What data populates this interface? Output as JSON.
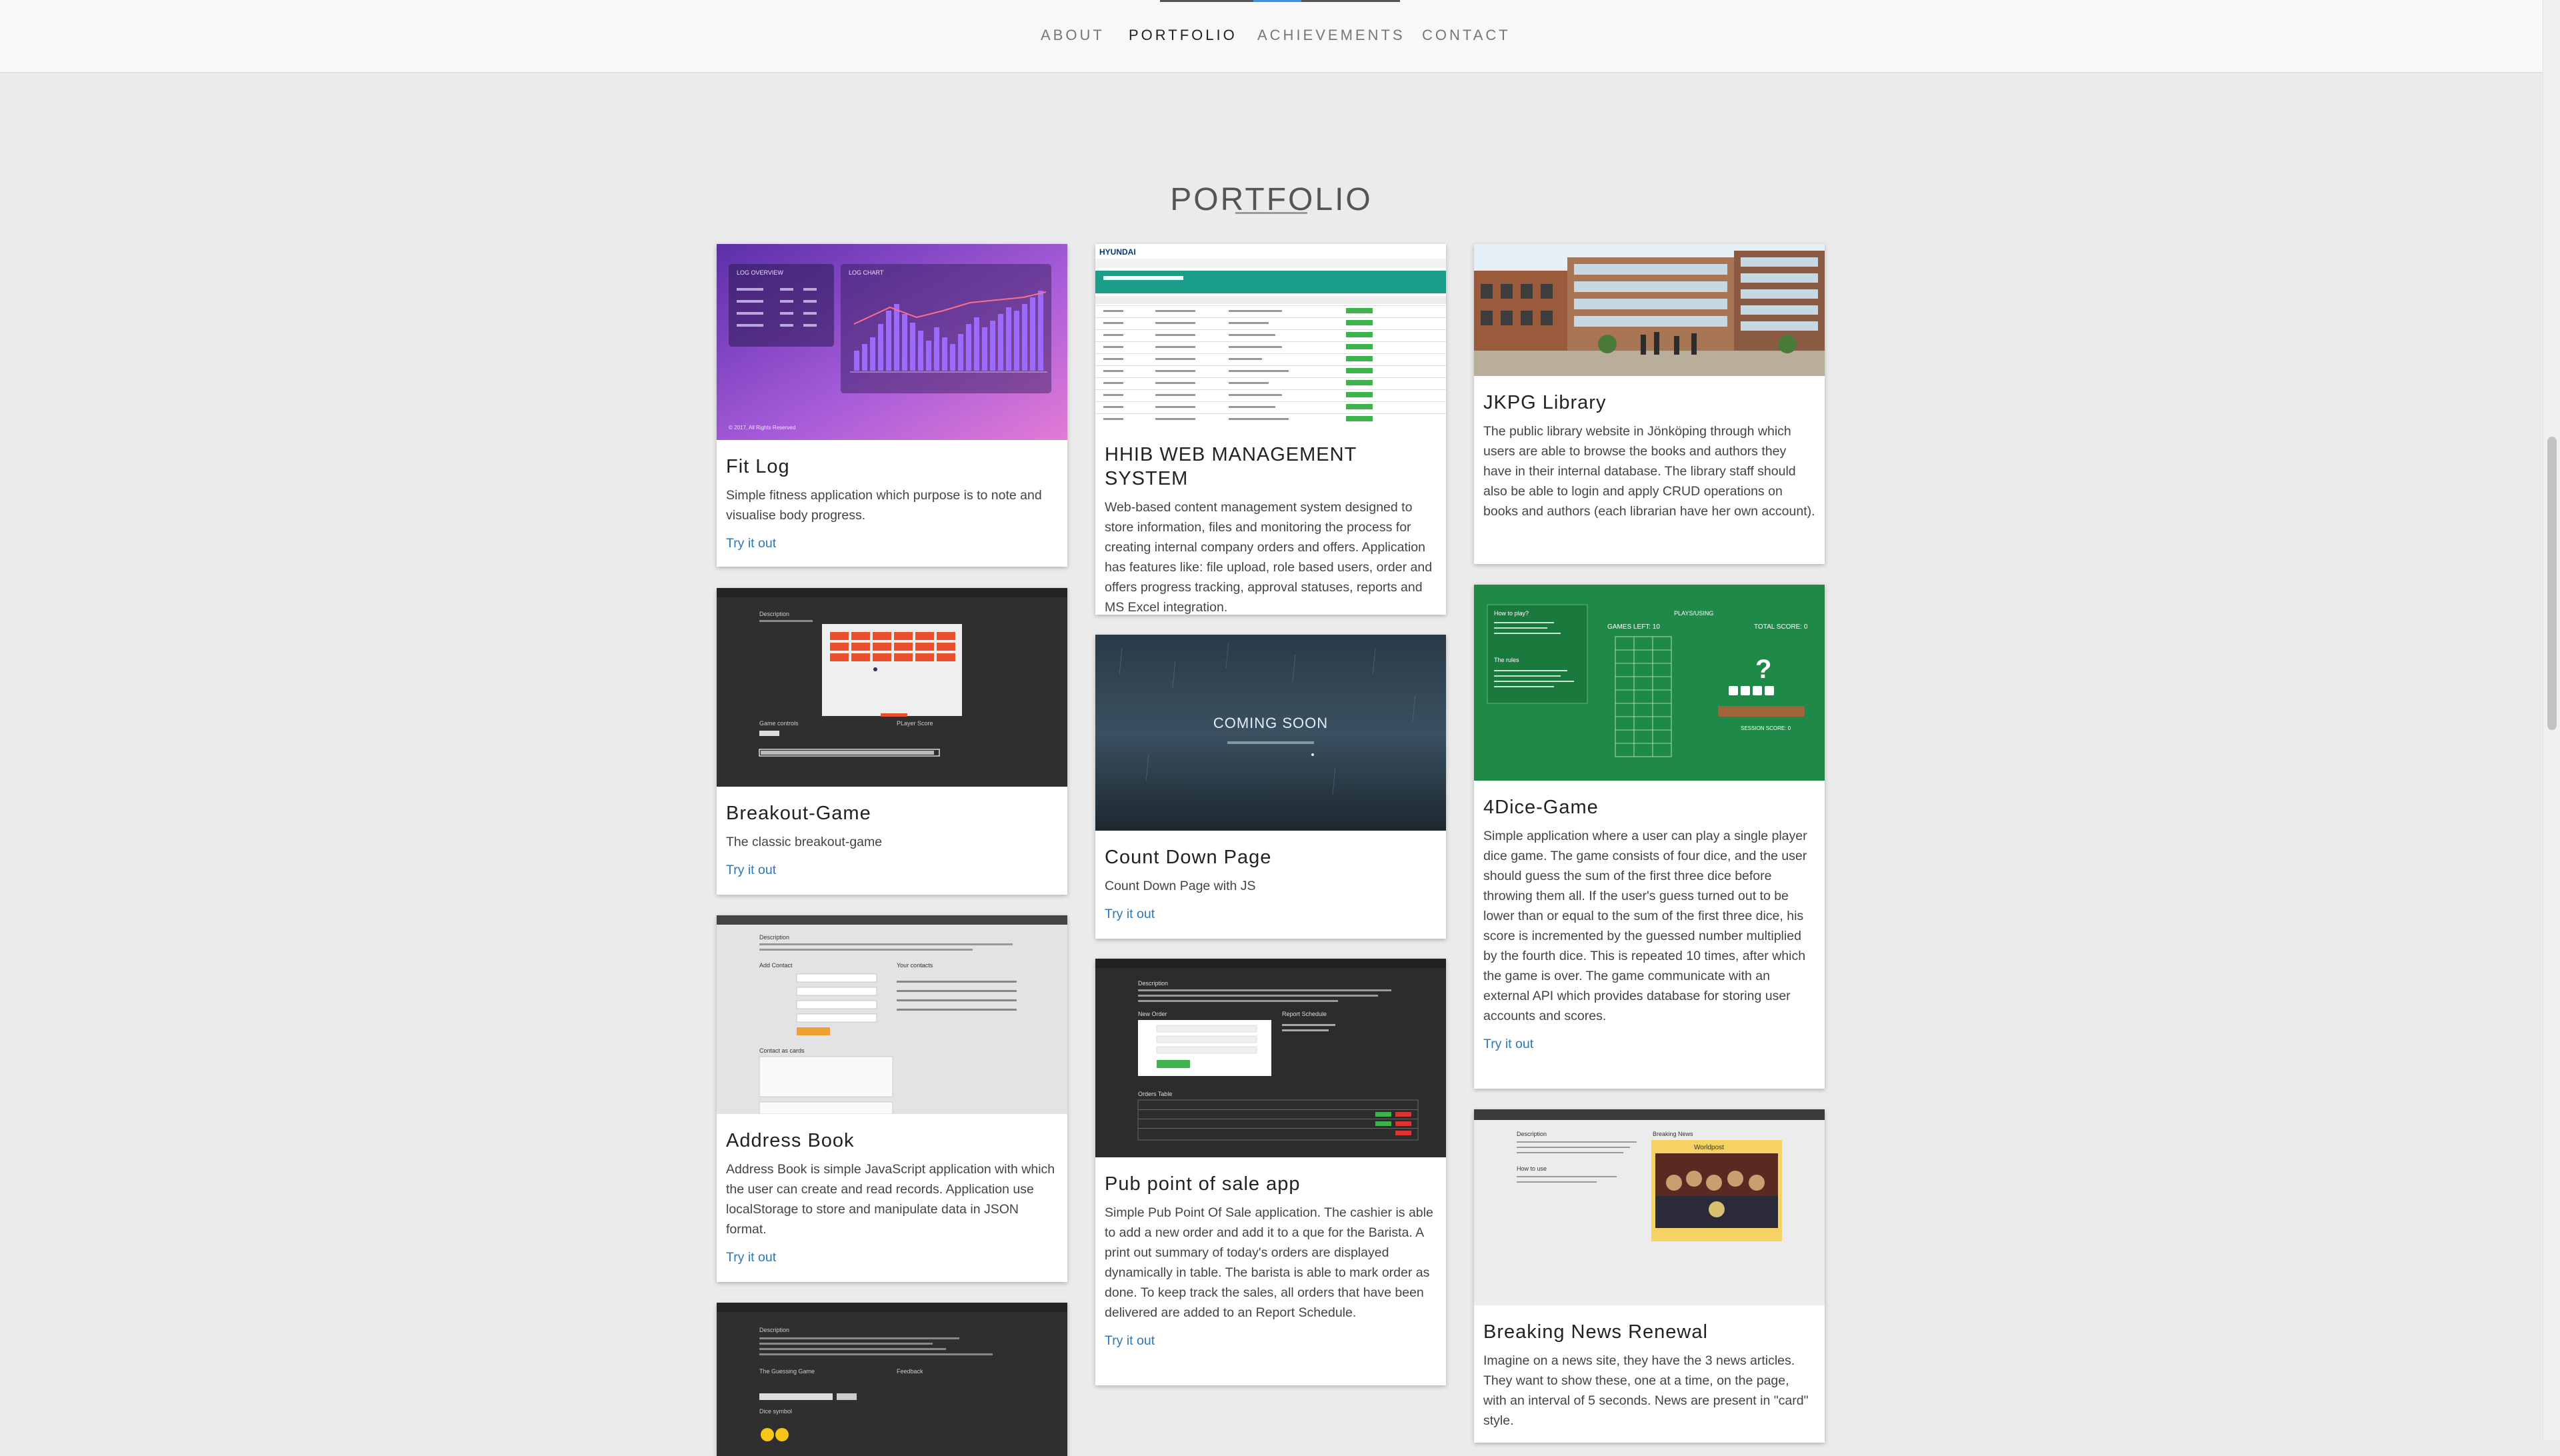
{
  "nav": {
    "items": [
      {
        "label": "ABOUT"
      },
      {
        "label": "PORTFOLIO"
      },
      {
        "label": "ACHIEVEMENTS"
      },
      {
        "label": "CONTACT"
      }
    ]
  },
  "portfolio": {
    "title": "PORTFOLIO",
    "cards": {
      "fitlog": {
        "title": "Fit Log",
        "desc": "Simple fitness application which purpose is to note and visualise body progress.",
        "link": "Try it out",
        "thumb": {
          "overview": "LOG OVERVIEW",
          "chart": "LOG CHART",
          "footer": "© 2017, All Rights Reserved"
        }
      },
      "hhib": {
        "title": "HHIB WEB MANAGEMENT SYSTEM",
        "desc": "Web-based content management system designed to store information, files and monitoring the process for creating internal company orders and offers. Application has features like: file upload, role based users, order and offers progress tracking, approval statuses, reports and MS Excel integration.",
        "thumb": {
          "brand": "HYUNDAI"
        }
      },
      "jkpg": {
        "title": "JKPG Library",
        "desc": "The public library website in Jönköping through which users are able to browse the books and authors they have in their internal database. The library staff should also be able to login and apply CRUD operations on books and authors (each librarian have her own account)."
      },
      "breakout": {
        "title": "Breakout-Game",
        "desc": "The classic breakout-game",
        "link": "Try it out",
        "thumb": {
          "desc_label": "Description",
          "controls": "Game controls",
          "score": "PLayer Score"
        }
      },
      "countdown": {
        "title": "Count Down Page",
        "desc": "Count Down Page with JS",
        "link": "Try it out",
        "thumb": {
          "heading": "COMING SOON"
        }
      },
      "dice": {
        "title": "4Dice-Game",
        "desc": "Simple application where a user can play a single player dice game. The game consists of four dice, and the user should guess the sum of the first three dice before throwing them all. If the user's guess turned out to be lower than or equal to the sum of the first three dice, his score is incremented by the guessed number multiplied by the fourth dice. This is repeated 10 times, after which the game is over. The game communicate with an external API which provides database for storing user accounts and scores.",
        "link": "Try it out",
        "thumb": {
          "howto": "How to play?",
          "rules": "The rules",
          "games_left": "GAMES LEFT: 10",
          "total": "TOTAL SCORE: 0",
          "session": "SESSION SCORE: 0",
          "playing": "PLAYS/USING",
          "question": "?"
        }
      },
      "address": {
        "title": "Address Book",
        "desc": "Address Book is simple JavaScript application with which the user can create and read records. Application use localStorage to store and manipulate data in JSON format.",
        "link": "Try it out",
        "thumb": {
          "desc_label": "Description",
          "add": "Add Contact",
          "contacts": "Your contacts",
          "cards": "Contact as cards"
        }
      },
      "pub": {
        "title": "Pub point of sale app",
        "desc": "Simple Pub Point Of Sale application. The cashier is able to add a new order and add it to a que for the Barista. A print out summary of today's orders are displayed dynamically in table. The barista is able to mark order as done. To keep track the sales, all orders that have been delivered are added to an Report Schedule.",
        "link": "Try it out",
        "thumb": {
          "desc_label": "Description",
          "new_order": "New Order",
          "report": "Report Schedule",
          "orders": "Orders Table"
        }
      },
      "news": {
        "title": "Breaking News Renewal",
        "desc": "Imagine on a news site, they have the 3 news articles. They want to show these, one at a time, on the page, with an interval of 5 seconds. News are present in \"card\" style.",
        "thumb": {
          "desc_label": "Description",
          "breaking": "Breaking News",
          "how": "How to use",
          "headline": "Worldpost"
        }
      },
      "guessing": {
        "thumb": {
          "desc_label": "Description",
          "game": "The Guessing Game",
          "feedback": "Feedback",
          "results": "Dice symbol"
        }
      }
    }
  }
}
